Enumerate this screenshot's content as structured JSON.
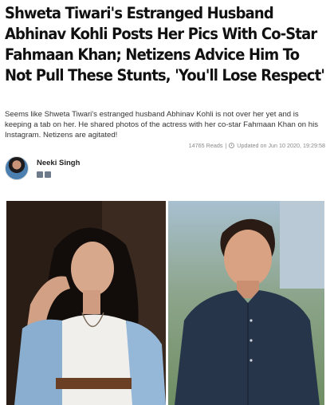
{
  "article": {
    "headline": "Shweta Tiwari's Estranged Husband Abhinav Kohli Posts Her Pics With Co-Star Fahmaan Khan; Netizens Advice Him To Not Pull These Stunts, 'You'll Lose Respect'",
    "summary": "Seems like Shweta Tiwari's estranged husband Abhinav Kohli is not over her yet and is keeping a tab on her. He shared photos of the actress with her co-star Fahmaan Khan on his Instagram. Netizens are agitated!",
    "reads": "14765 Reads",
    "separator": "|",
    "updated": "Updated on Jun 10 2020, 19:29:58"
  },
  "author": {
    "name": "Neeki Singh",
    "social_icons": [
      "email-icon",
      "twitter-icon"
    ]
  },
  "photos": {
    "left_icon": "photo-woman",
    "right_icon": "photo-man"
  }
}
